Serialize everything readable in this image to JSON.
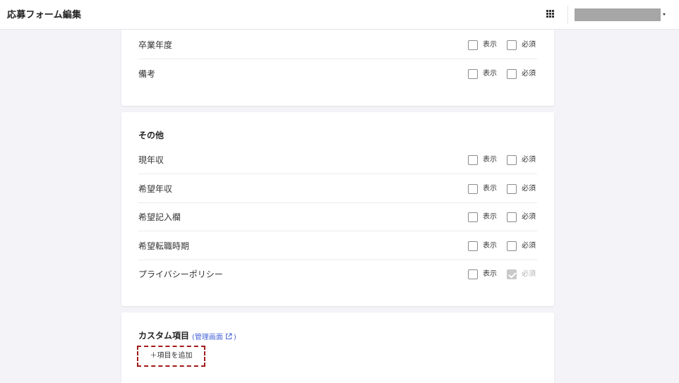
{
  "header": {
    "title": "応募フォーム編集",
    "apps_icon": "grid-icon",
    "account_caret_icon": "caret-down-icon"
  },
  "options": {
    "show_label": "表示",
    "required_label": "必須"
  },
  "section_education": {
    "rows": [
      {
        "label": "卒業年度",
        "show_checked": false,
        "required_checked": false
      },
      {
        "label": "備考",
        "show_checked": false,
        "required_checked": false
      }
    ]
  },
  "section_other": {
    "title": "その他",
    "rows": [
      {
        "label": "現年収",
        "show_checked": false,
        "required_checked": false
      },
      {
        "label": "希望年収",
        "show_checked": false,
        "required_checked": false
      },
      {
        "label": "希望記入欄",
        "show_checked": false,
        "required_checked": false
      },
      {
        "label": "希望転職時期",
        "show_checked": false,
        "required_checked": false
      },
      {
        "label": "プライバシーポリシー",
        "show_checked": false,
        "required_checked": true,
        "required_disabled": true
      }
    ]
  },
  "section_custom": {
    "title": "カスタム項目",
    "paren_open": "(",
    "link_label": "管理画面",
    "paren_close": ")",
    "link_icon": "external-link-icon",
    "add_button_label": "＋項目を追加"
  },
  "colors": {
    "background": "#f3f3f8",
    "link": "#4a66d9",
    "add_button_border": "#a11a1a"
  }
}
